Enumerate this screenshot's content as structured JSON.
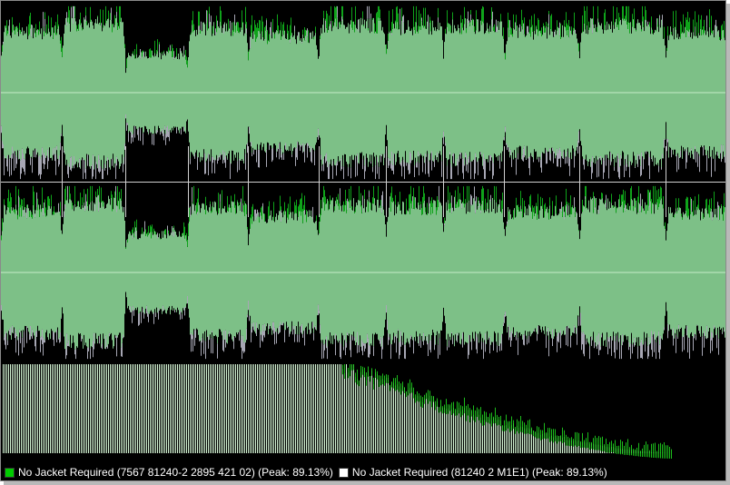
{
  "colors": {
    "background": "#000000",
    "waveform_fill": "#7dc087",
    "waveform_peak_a": "#0fa31a",
    "waveform_peak_b": "#a7a7b4",
    "center_line": "#c8ecc8",
    "separator": "#d0d0d0",
    "spectrum_fill": "#d6f7d6",
    "spectrum_peak": "#20d020",
    "legend_a": "#00cc00",
    "legend_b": "#ffffff"
  },
  "track_boundaries": [
    0.084,
    0.171,
    0.257,
    0.34,
    0.437,
    0.53,
    0.609,
    0.693,
    0.796,
    0.915
  ],
  "track_levels": [
    0.84,
    0.95,
    0.52,
    0.88,
    0.77,
    0.93,
    0.9,
    0.92,
    0.83,
    0.92,
    0.82,
    0.46
  ],
  "spectrum": {
    "flat_level": 1.0,
    "rolloff_start": 0.465,
    "rolloff_end": 0.925
  },
  "legend": [
    {
      "label": "No Jacket Required (7567 81240-2 2895 421 02) (Peak: 89.13%)",
      "color": "#00cc00"
    },
    {
      "label": "No Jacket Required (81240 2 M1E1) (Peak: 89.13%)",
      "color": "#ffffff"
    }
  ]
}
